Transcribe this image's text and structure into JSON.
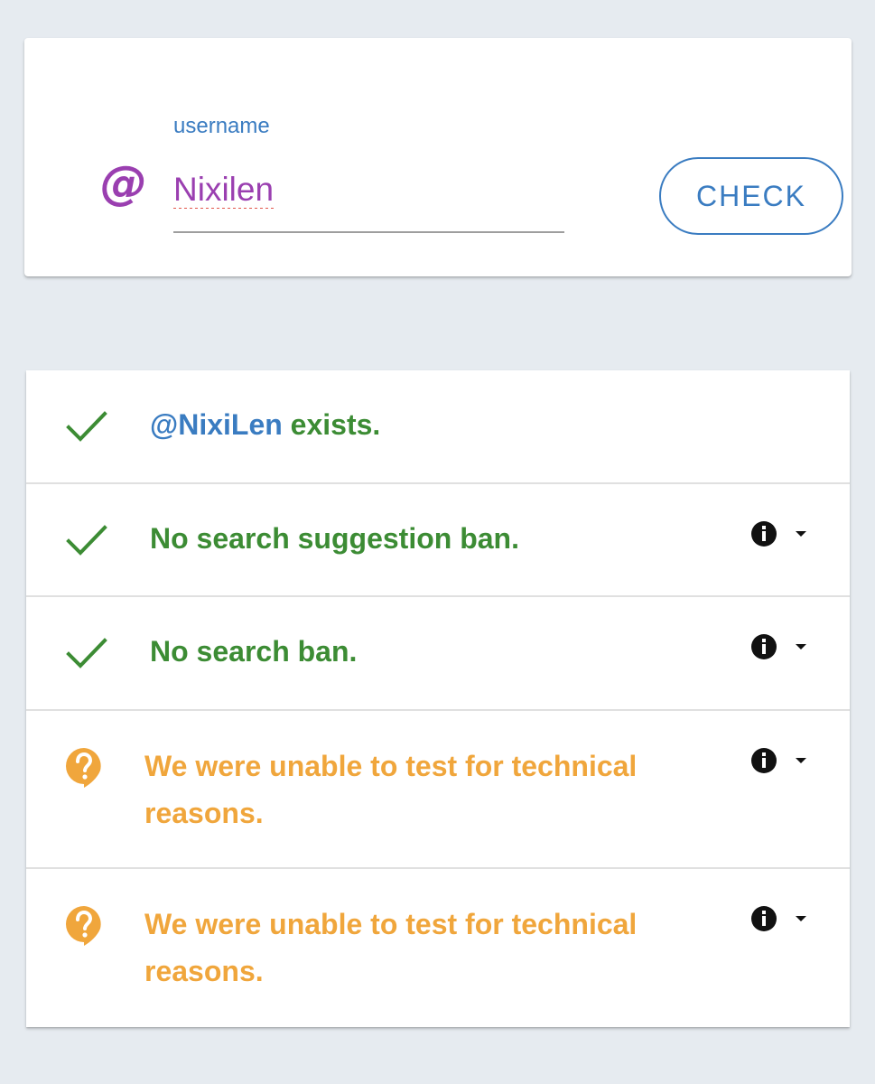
{
  "search": {
    "label": "username",
    "value": "Nixilen",
    "at_symbol": "@",
    "button_label": "CHECK"
  },
  "results": {
    "exists": {
      "handle": "@NixiLen",
      "text": " exists.",
      "status": "pass",
      "icon": "check-icon"
    },
    "suggestion_ban": {
      "text": "No search suggestion ban.",
      "status": "pass",
      "icon": "check-icon"
    },
    "search_ban": {
      "text": "No search ban.",
      "status": "pass",
      "icon": "check-icon"
    },
    "test_4": {
      "text": "We were unable to test for technical reasons.",
      "status": "unknown",
      "icon": "question-icon"
    },
    "test_5": {
      "text": "We were unable to test for technical reasons.",
      "status": "unknown",
      "icon": "question-icon"
    }
  },
  "colors": {
    "background": "#e6ebf0",
    "accent_blue": "#3a7cc1",
    "at_purple": "#9a3fb0",
    "pass_green": "#3c8c34",
    "unknown_orange": "#f0a63c"
  }
}
